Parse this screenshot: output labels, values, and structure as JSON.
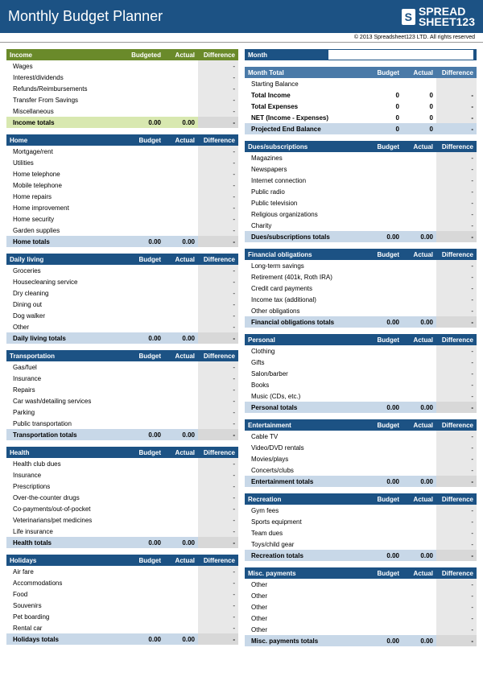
{
  "header": {
    "title": "Monthly Budget Planner",
    "brand": "SPREAD\nSHEET",
    "brand_num": "123"
  },
  "copyright": "© 2013 Spreadsheet123 LTD. All rights reserved",
  "cols": {
    "budgeted": "Budgeted",
    "budget": "Budget",
    "actual": "Actual",
    "diff": "Difference"
  },
  "dash": "-",
  "zero2": "0.00",
  "zero": "0",
  "month": {
    "label": "Month",
    "value": ""
  },
  "summary": {
    "title": "Month Total",
    "rows": [
      {
        "label": "Starting Balance",
        "b": "",
        "a": "",
        "d": ""
      },
      {
        "label": "Total Income",
        "b": "0",
        "a": "0",
        "d": "-"
      },
      {
        "label": "Total Expenses",
        "b": "0",
        "a": "0",
        "d": "-"
      },
      {
        "label": "NET (Income - Expenses)",
        "b": "0",
        "a": "0",
        "d": "-"
      }
    ],
    "proj": {
      "label": "Projected End Balance",
      "b": "0",
      "a": "0",
      "d": "-"
    }
  },
  "left": [
    {
      "title": "Income",
      "green": true,
      "items": [
        "Wages",
        "Interest/dividends",
        "Refunds/Reimbursements",
        "Transfer From Savings",
        "Miscellaneous"
      ],
      "total": "Income totals"
    },
    {
      "title": "Home",
      "items": [
        "Mortgage/rent",
        "Utilities",
        "Home telephone",
        "Mobile telephone",
        "Home repairs",
        "Home improvement",
        "Home security",
        "Garden supplies"
      ],
      "total": "Home totals"
    },
    {
      "title": "Daily living",
      "items": [
        "Groceries",
        "Housecleaning service",
        "Dry cleaning",
        "Dining out",
        "Dog walker",
        "Other"
      ],
      "total": "Daily living totals"
    },
    {
      "title": "Transportation",
      "items": [
        "Gas/fuel",
        "Insurance",
        "Repairs",
        "Car wash/detailing services",
        "Parking",
        "Public transportation"
      ],
      "total": "Transportation totals"
    },
    {
      "title": "Health",
      "items": [
        "Health club dues",
        "Insurance",
        "Prescriptions",
        "Over-the-counter drugs",
        "Co-payments/out-of-pocket",
        "Veterinarians/pet medicines",
        "Life insurance"
      ],
      "total": "Health totals"
    },
    {
      "title": "Holidays",
      "items": [
        "Air fare",
        "Accommodations",
        "Food",
        "Souvenirs",
        "Pet boarding",
        "Rental car"
      ],
      "total": "Holidays totals"
    }
  ],
  "right": [
    {
      "title": "Dues/subscriptions",
      "items": [
        "Magazines",
        "Newspapers",
        "Internet connection",
        "Public radio",
        "Public television",
        "Religious organizations",
        "Charity"
      ],
      "total": "Dues/subscriptions totals"
    },
    {
      "title": "Financial obligations",
      "items": [
        "Long-term savings",
        "Retirement (401k, Roth IRA)",
        "Credit card payments",
        "Income tax (additional)",
        "Other obligations"
      ],
      "total": "Financial obligations totals"
    },
    {
      "title": "Personal",
      "items": [
        "Clothing",
        "Gifts",
        "Salon/barber",
        "Books",
        "Music (CDs, etc.)"
      ],
      "total": "Personal totals"
    },
    {
      "title": "Entertainment",
      "items": [
        "Cable TV",
        "Video/DVD rentals",
        "Movies/plays",
        "Concerts/clubs"
      ],
      "total": "Entertainment totals"
    },
    {
      "title": "Recreation",
      "items": [
        "Gym fees",
        "Sports equipment",
        "Team dues",
        "Toys/child gear"
      ],
      "total": "Recreation totals"
    },
    {
      "title": "Misc. payments",
      "items": [
        "Other",
        "Other",
        "Other",
        "Other",
        "Other"
      ],
      "total": "Misc. payments totals"
    }
  ]
}
